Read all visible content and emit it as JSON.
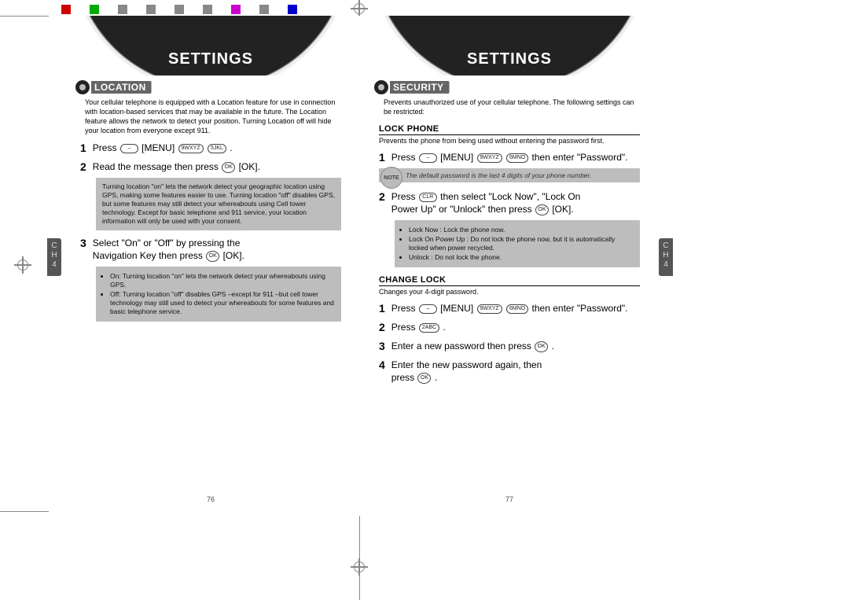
{
  "chapter_tab": {
    "line1": "C",
    "line2": "H",
    "line3": "4"
  },
  "left": {
    "header": "SETTINGS",
    "section": "LOCATION",
    "intro": "Your cellular telephone is equipped with a Location feature for use in connection with location-based services that may be available in the future. The Location feature allows the network to detect your position. Turning Location off will hide your location from everyone except 911.",
    "step1_pre": "Press ",
    "step1_mid": " [MENU] ",
    "step1_post": ".",
    "step2_pre": "Read the message then press ",
    "step2_post": " [OK].",
    "gray1": "Turning location \"on\" lets the network detect your geographic location using GPS, making some features easier to use. Turning location \"off\" disables GPS, but some features may still detect your whereabouts using Cell tower technology. Except for basic telephone and 911 service, your location information will only be used with your consent.",
    "step3_a": "Select \"On\" or \"Off\" by pressing the",
    "step3_b": "Navigation Key then press ",
    "step3_c": " [OK].",
    "gray2_on": "On: Turning location \"on\" lets the network detect your whereabouts using GPS.",
    "gray2_off": "Off: Turning location \"off\" disables GPS –except for 911 –but cell tower technology may still used to detect your whereabouts for some features and basic telephone service.",
    "page_num": "76"
  },
  "right": {
    "header": "SETTINGS",
    "section": "SECURITY",
    "intro": "Prevents unauthorized use of your cellular telephone. The following settings can be restricted:",
    "sub_lock": "LOCK PHONE",
    "lock_legend": "Prevents the phone from being used without entering the password first.",
    "lock_step1_pre": "Press ",
    "lock_step1_mid": " [MENU] ",
    "lock_step1_post": " then enter \"Password\".",
    "note_text": "The default password is the last 4 digits of your phone number.",
    "note_badge": "NOTE",
    "lock_step2_a": "Press ",
    "lock_step2_b": " then select \"Lock Now\", \"Lock On",
    "lock_step2_c": "Power Up\" or \"Unlock\" then press ",
    "lock_step2_d": " [OK].",
    "gray_lock_now": "Lock Now : Lock the phone now.",
    "gray_lock_power": "Lock On Power Up : Do not lock the phone now, but it is automatically locked when power recycled.",
    "gray_unlock": "Unlock : Do not lock the phone.",
    "sub_change": "CHANGE LOCK",
    "change_legend": "Changes your 4-digit password.",
    "change1_pre": "Press ",
    "change1_mid": " [MENU] ",
    "change1_post": " then enter \"Password\".",
    "change2_pre": "Press ",
    "change2_post": ".",
    "change3_pre": "Enter a new password then press ",
    "change3_post": " .",
    "change4_a": "Enter the new password again, then",
    "change4_b": "press ",
    "change4_c": " .",
    "page_num": "77",
    "key_labels": {
      "ok": "OK",
      "nine": "9WXYZ",
      "five": "5JKL",
      "six": "6MNO",
      "two": "2ABC",
      "clr": "CLR",
      "soft": "—"
    }
  }
}
